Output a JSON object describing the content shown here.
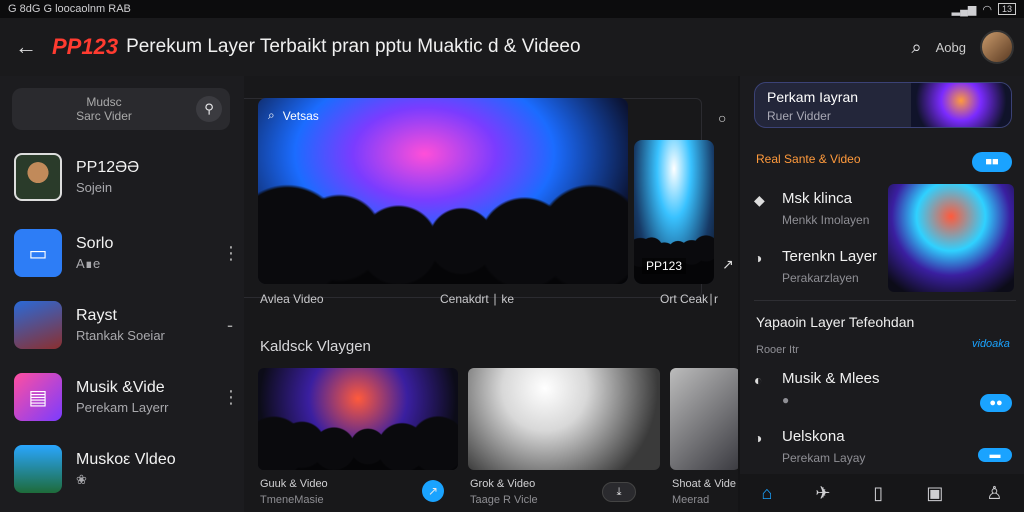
{
  "status": {
    "left": "G 8dG G loocaolnm RAB",
    "right": "13"
  },
  "header": {
    "back_icon": "arrow-left-icon",
    "brand": "PP123",
    "title": "Perekum Layer Terbaikt pran pptu Muaktic d & Videeo",
    "user_label": "Aobg"
  },
  "sidebar": {
    "search": {
      "line1": "Mudsc",
      "line2": "Sarc Vider"
    },
    "items": [
      {
        "title": "PP12ƏƏ",
        "subtitle": "Sojein"
      },
      {
        "title": "Sorlo",
        "subtitle": "A∎e"
      },
      {
        "title": "Rayst",
        "subtitle": "Rtankak Soeiar"
      },
      {
        "title": "Musik &Vide",
        "subtitle": "Perekam Layerr"
      },
      {
        "title": "Muskoε Vldeo",
        "subtitle": "❀"
      }
    ]
  },
  "main": {
    "hero": {
      "label": "Vetsas",
      "badge": "PP123",
      "caption_left": "Avlea Video",
      "caption_mid": "Cenakdrt ∣ ke",
      "caption_right": "Ort Ceak∣r"
    },
    "section_title": "Kaldsck Vlaygen",
    "cards": [
      {
        "title": "Guuk & Video",
        "subtitle": "TmeneMasie"
      },
      {
        "title": "Grok & Video",
        "subtitle": "Taage R Vicle"
      },
      {
        "title": "Shoat & Vide",
        "subtitle": "Meerad"
      }
    ]
  },
  "right": {
    "promo": {
      "title": "Perkam Iayran",
      "subtitle": "Ruer Vidder"
    },
    "section1": {
      "title": "Real Sante & Video",
      "pill": "■■"
    },
    "items": [
      {
        "title": "Msk klinca",
        "subtitle": "Menkk Imolayen"
      },
      {
        "title": "Terenkn Layer",
        "subtitle": "Perakarzlayen"
      }
    ],
    "section2": {
      "title": "Yapaoin Layer Tefeohdan",
      "sub": "Rooer Itr",
      "link": "vidoaka"
    },
    "items2": [
      {
        "title": "Musik & Mlees",
        "subtitle": "●"
      },
      {
        "title": "Uelskona",
        "subtitle": "Perekam Layay"
      }
    ]
  }
}
